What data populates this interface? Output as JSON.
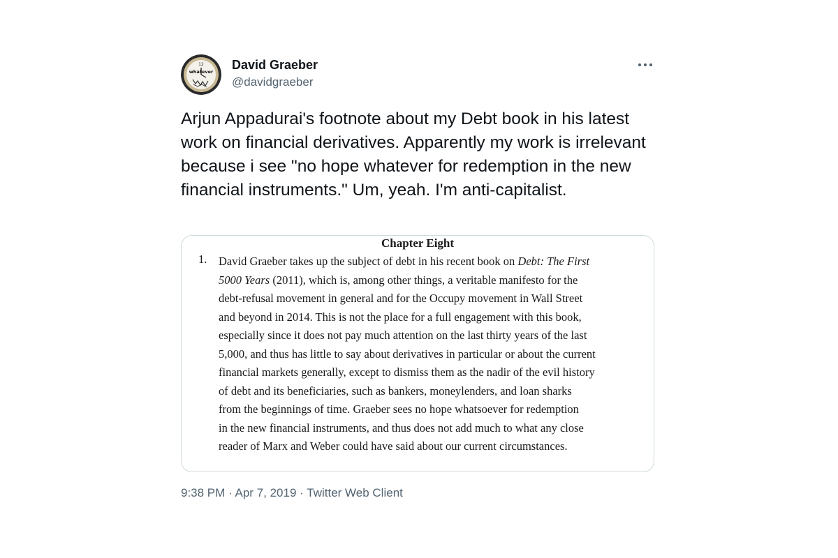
{
  "author": {
    "name": "David Graeber",
    "handle": "@davidgraeber",
    "avatar_icon": "clock-whatever-avatar-icon",
    "avatar_text": "whatever"
  },
  "more_icon": "more-horizontal-icon",
  "tweet": {
    "text": "Arjun Appadurai's footnote about my Debt book in his latest work on financial derivatives. Apparently my work is irrelevant because i see \"no hope whatever for redemption in the new financial instruments.\" Um, yeah. I'm anti-capitalist."
  },
  "media": {
    "chapter_title": "Chapter Eight",
    "footnote_number": "1.",
    "footnote_lines": [
      {
        "pre": "David Graeber takes up the subject of debt in his recent book on ",
        "em": "Debt: The First",
        "post": ""
      },
      {
        "pre": "",
        "em": "5000 Years",
        "post": " (2011), which is, among other things, a veritable manifesto for the"
      },
      {
        "pre": "debt-refusal movement in general and for the Occupy movement in Wall Street",
        "em": "",
        "post": ""
      },
      {
        "pre": "and beyond in 2014. This is not the place for a full engagement with this book,",
        "em": "",
        "post": ""
      },
      {
        "pre": "especially since it does not pay much attention on the last thirty years of the last",
        "em": "",
        "post": ""
      },
      {
        "pre": "5,000, and thus has little to say about derivatives in particular or about the current",
        "em": "",
        "post": ""
      },
      {
        "pre": "financial markets generally, except to dismiss them as the nadir of the evil history",
        "em": "",
        "post": ""
      },
      {
        "pre": "of debt and its beneficiaries, such as bankers, moneylenders, and loan sharks",
        "em": "",
        "post": ""
      },
      {
        "pre": "from the beginnings of time. Graeber sees no hope whatsoever for redemption",
        "em": "",
        "post": ""
      },
      {
        "pre": "in the new financial instruments, and thus does not add much to what any close",
        "em": "",
        "post": ""
      },
      {
        "pre": "reader of Marx and Weber could have said about our current circumstances.",
        "em": "",
        "post": ""
      }
    ]
  },
  "meta": {
    "time": "9:38 PM",
    "separator": "·",
    "date": "Apr 7, 2019",
    "source": "Twitter Web Client"
  },
  "colors": {
    "text_primary": "#0f1419",
    "text_secondary": "#536471",
    "border": "#cfd9de"
  }
}
